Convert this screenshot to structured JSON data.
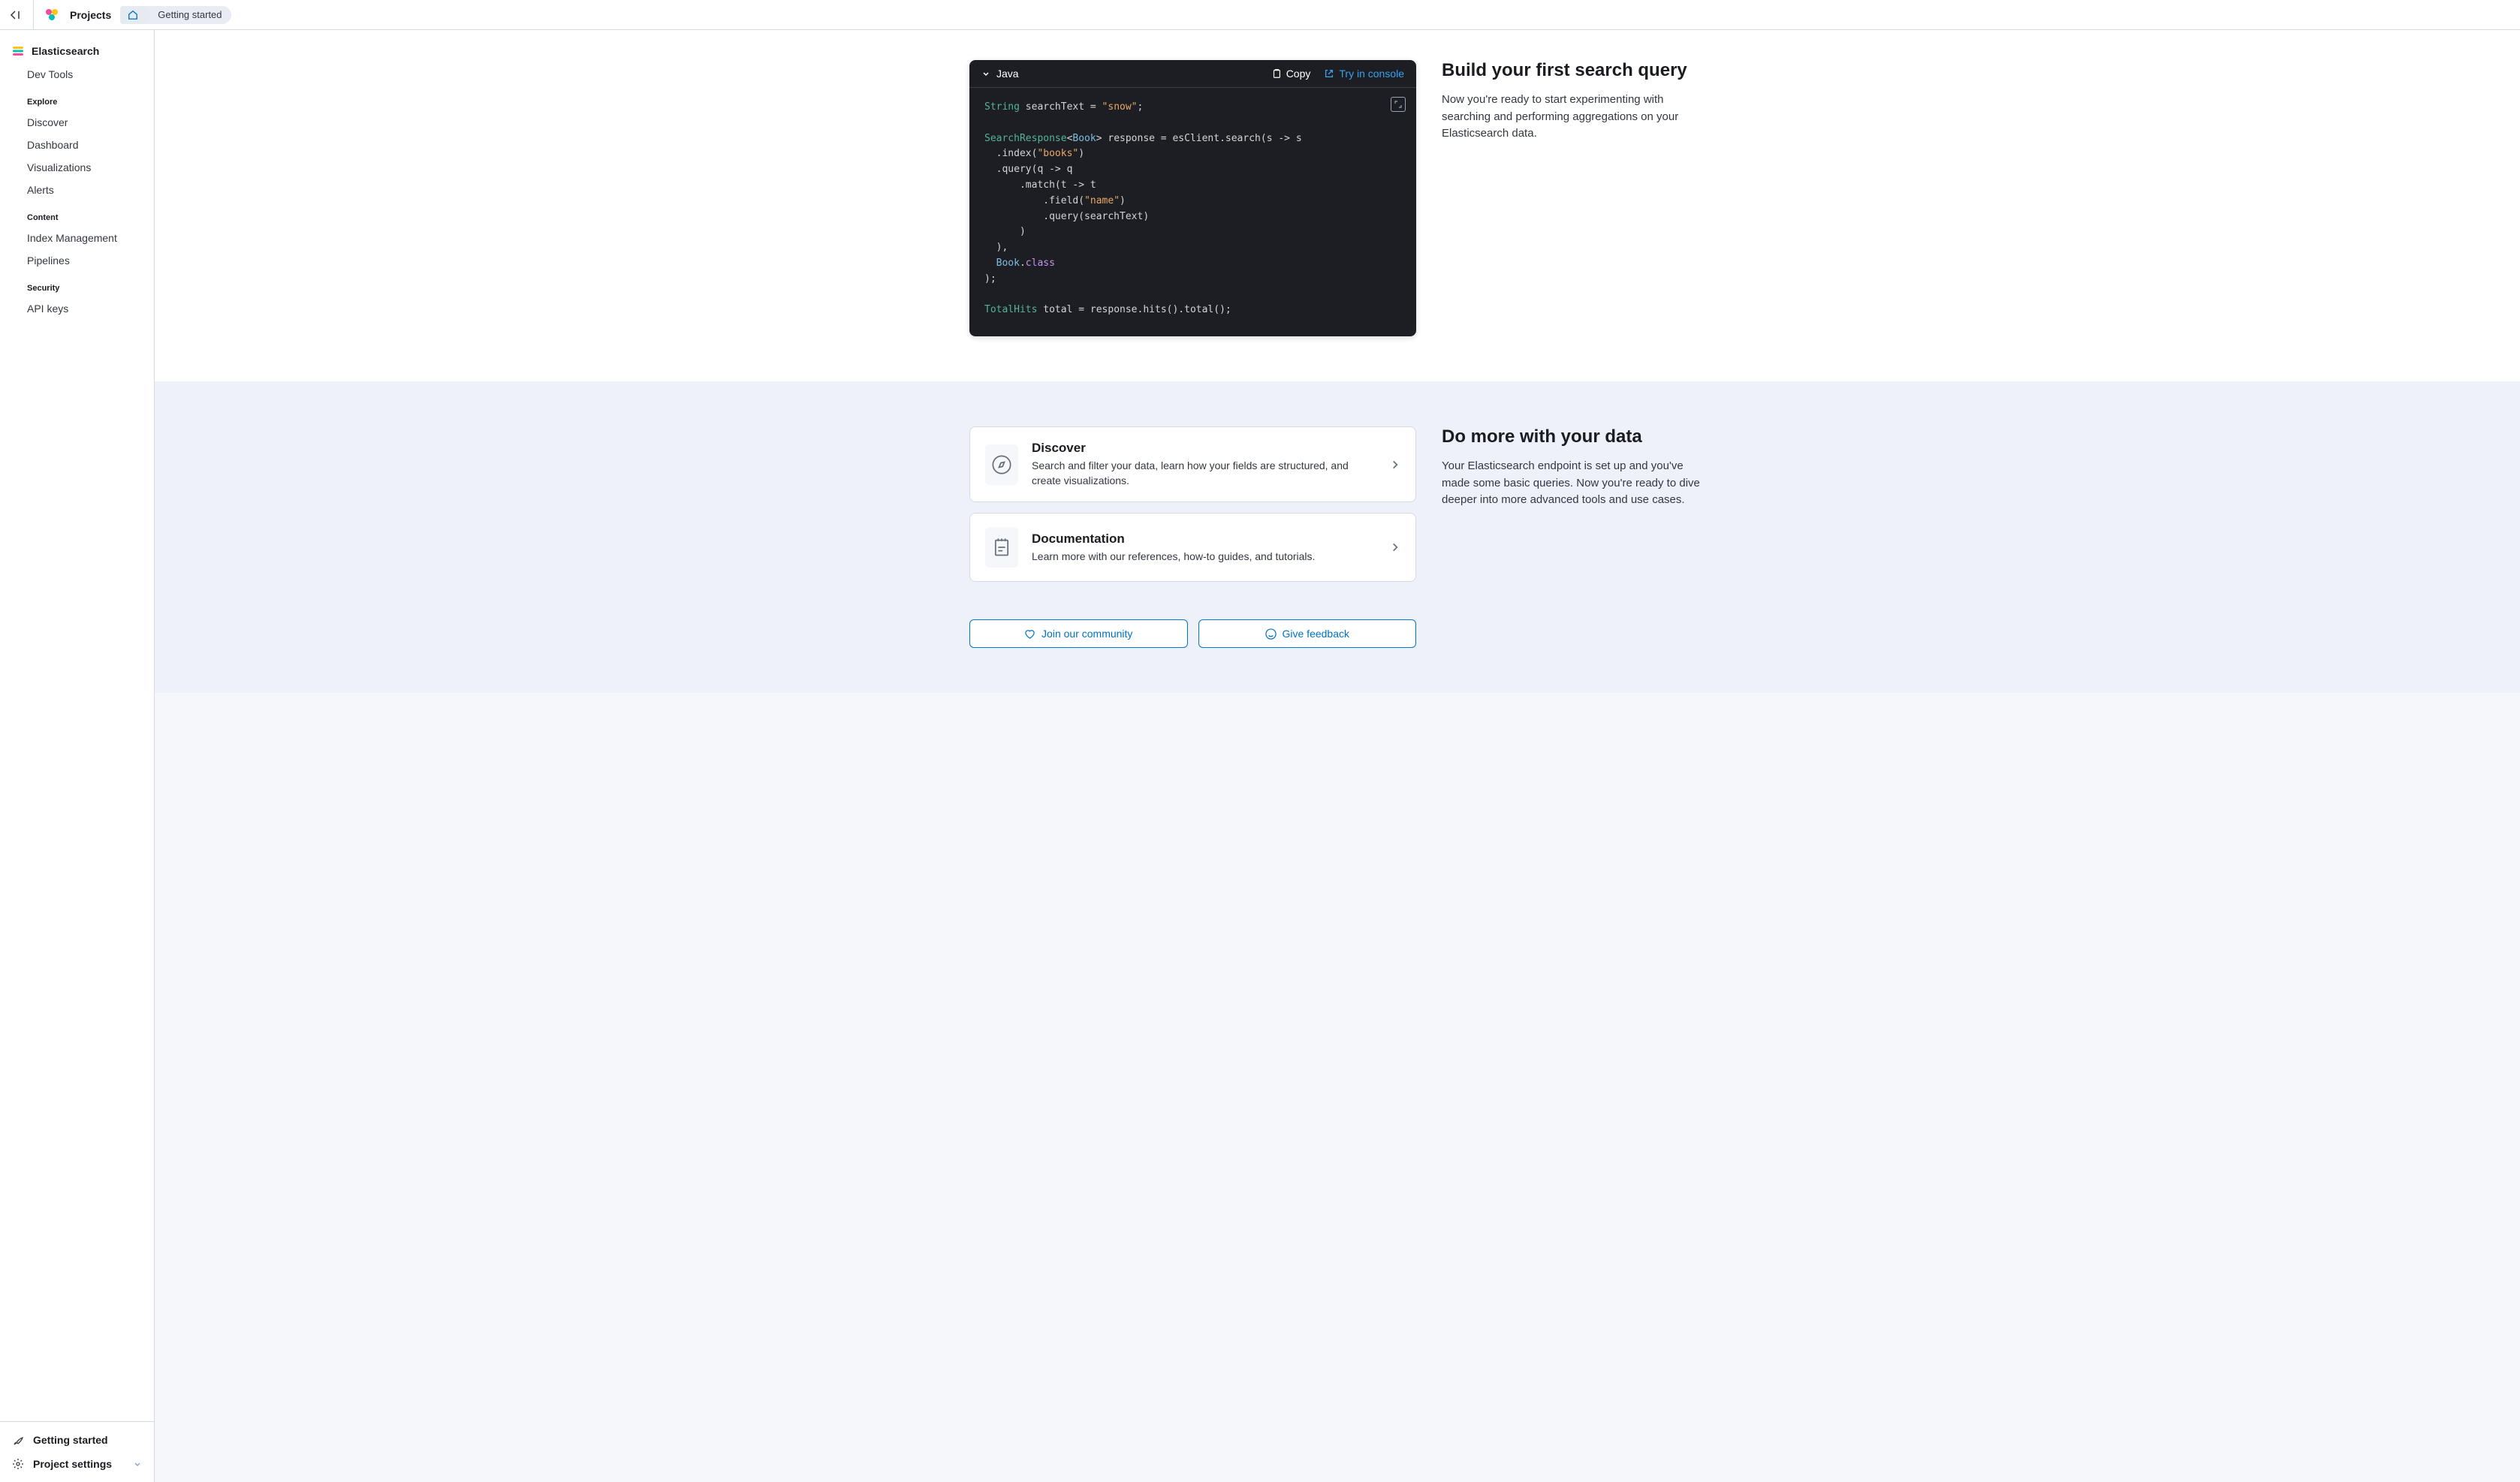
{
  "header": {
    "projects_label": "Projects",
    "breadcrumb_current": "Getting started"
  },
  "sidebar": {
    "app_name": "Elasticsearch",
    "dev_tools": "Dev Tools",
    "sections": {
      "explore": {
        "label": "Explore",
        "items": [
          "Discover",
          "Dashboard",
          "Visualizations",
          "Alerts"
        ]
      },
      "content": {
        "label": "Content",
        "items": [
          "Index Management",
          "Pipelines"
        ]
      },
      "security": {
        "label": "Security",
        "items": [
          "API keys"
        ]
      }
    },
    "footer": {
      "getting_started": "Getting started",
      "project_settings": "Project settings"
    }
  },
  "code_panel": {
    "language": "Java",
    "copy_label": "Copy",
    "try_label": "Try in console",
    "tokens": [
      [
        {
          "t": "type",
          "v": "String"
        },
        {
          "t": "plain",
          "v": " searchText = "
        },
        {
          "t": "str",
          "v": "\"snow\""
        },
        {
          "t": "plain",
          "v": ";"
        }
      ],
      [],
      [
        {
          "t": "type",
          "v": "SearchResponse"
        },
        {
          "t": "plain",
          "v": "<"
        },
        {
          "t": "class",
          "v": "Book"
        },
        {
          "t": "plain",
          "v": "> response = esClient.search(s -> s"
        }
      ],
      [
        {
          "t": "plain",
          "v": "  .index("
        },
        {
          "t": "str",
          "v": "\"books\""
        },
        {
          "t": "plain",
          "v": ")"
        }
      ],
      [
        {
          "t": "plain",
          "v": "  .query(q -> q"
        }
      ],
      [
        {
          "t": "plain",
          "v": "      .match(t -> t"
        }
      ],
      [
        {
          "t": "plain",
          "v": "          .field("
        },
        {
          "t": "str",
          "v": "\"name\""
        },
        {
          "t": "plain",
          "v": ")"
        }
      ],
      [
        {
          "t": "plain",
          "v": "          .query(searchText)"
        }
      ],
      [
        {
          "t": "plain",
          "v": "      )"
        }
      ],
      [
        {
          "t": "plain",
          "v": "  ),"
        }
      ],
      [
        {
          "t": "plain",
          "v": "  "
        },
        {
          "t": "class",
          "v": "Book"
        },
        {
          "t": "plain",
          "v": "."
        },
        {
          "t": "kw",
          "v": "class"
        }
      ],
      [
        {
          "t": "plain",
          "v": ");"
        }
      ],
      [],
      [
        {
          "t": "type",
          "v": "TotalHits"
        },
        {
          "t": "plain",
          "v": " total = response.hits().total();"
        }
      ]
    ]
  },
  "build_query": {
    "title": "Build your first search query",
    "description": "Now you're ready to start experimenting with searching and performing aggregations on your Elasticsearch data."
  },
  "do_more": {
    "title": "Do more with your data",
    "description": "Your Elasticsearch endpoint is set up and you've made some basic queries. Now you're ready to dive deeper into more advanced tools and use cases."
  },
  "cards": {
    "discover": {
      "title": "Discover",
      "description": "Search and filter your data, learn how your fields are structured, and create visualizations."
    },
    "documentation": {
      "title": "Documentation",
      "description": "Learn more with our references, how-to guides, and tutorials."
    }
  },
  "footer_buttons": {
    "community": "Join our community",
    "feedback": "Give feedback"
  }
}
